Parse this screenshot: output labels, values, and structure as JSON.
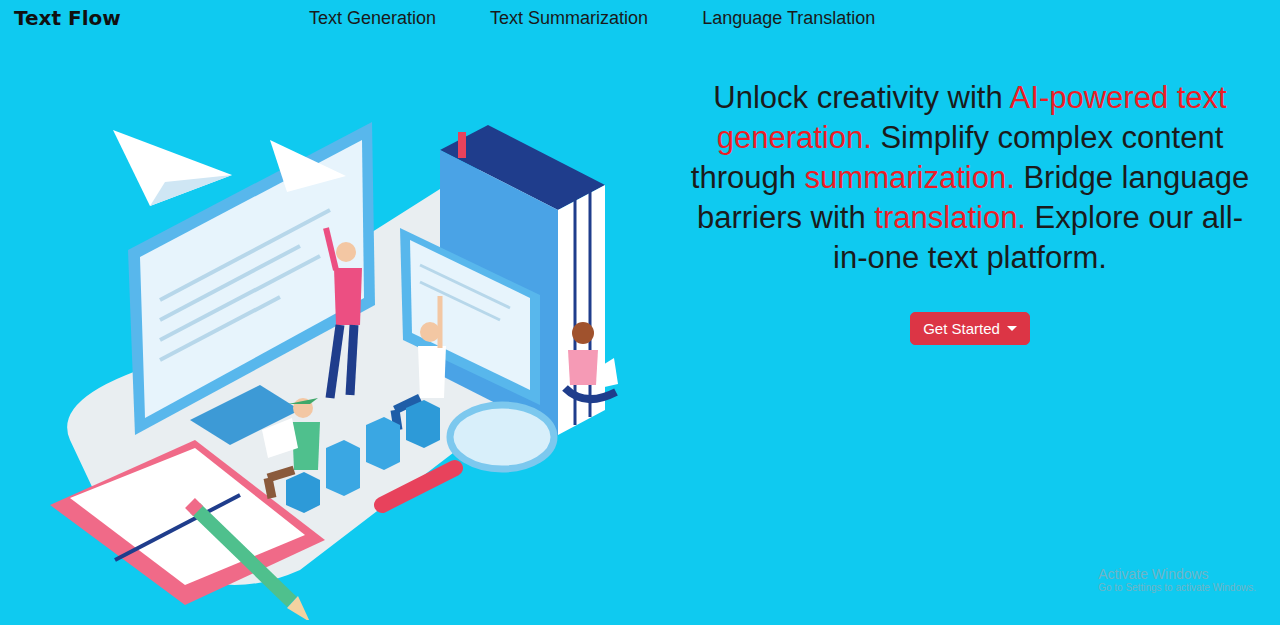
{
  "brand": "Text Flow",
  "nav": [
    {
      "label": "Text Generation"
    },
    {
      "label": "Text Summarization"
    },
    {
      "label": "Language Translation"
    }
  ],
  "hero": {
    "segments": [
      {
        "text": "Unlock creativity with ",
        "highlight": false
      },
      {
        "text": "AI-powered text generation.",
        "highlight": true
      },
      {
        "text": " Simplify complex content through ",
        "highlight": false
      },
      {
        "text": "summarization.",
        "highlight": true
      },
      {
        "text": " Bridge language barriers with ",
        "highlight": false
      },
      {
        "text": "translation.",
        "highlight": true
      },
      {
        "text": " Explore our all-in-one text platform.",
        "highlight": false
      }
    ]
  },
  "cta": {
    "label": "Get Started"
  },
  "watermark": {
    "title": "Activate Windows",
    "subtitle": "Go to Settings to activate Windows."
  }
}
